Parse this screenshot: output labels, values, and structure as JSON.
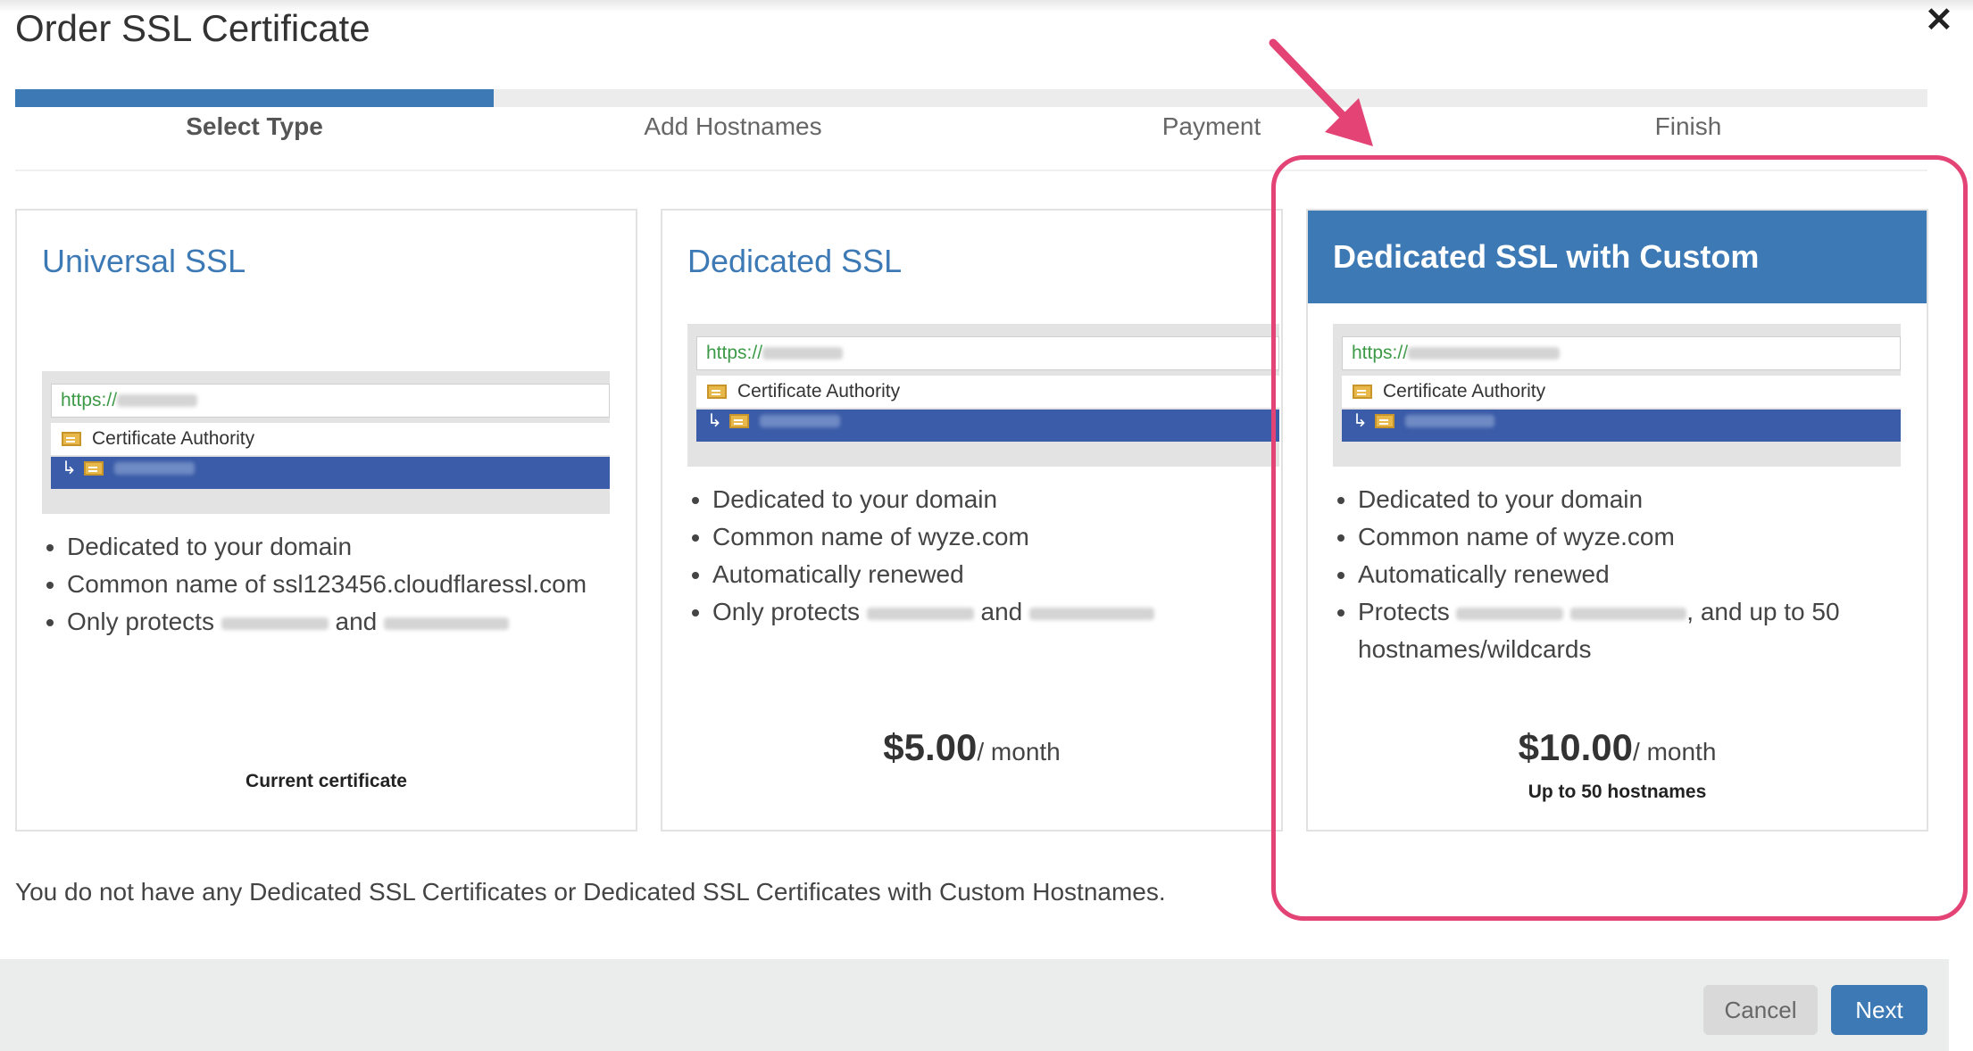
{
  "modal": {
    "title": "Order SSL Certificate"
  },
  "steps": [
    "Select Type",
    "Add Hostnames",
    "Payment",
    "Finish"
  ],
  "cards": [
    {
      "title": "Universal SSL",
      "cert": {
        "https": "https://",
        "ca": "Certificate Authority"
      },
      "features": [
        "Dedicated to your domain",
        "Common name of ssl123456.cloudflaressl.com",
        "Only protects",
        "and"
      ],
      "note": "Current certificate"
    },
    {
      "title": "Dedicated SSL",
      "cert": {
        "https": "https://",
        "ca": "Certificate Authority"
      },
      "features": [
        "Dedicated to your domain",
        "Common name of wyze.com",
        "Automatically renewed",
        "Only protects",
        "and"
      ],
      "price": {
        "amount": "$5.00",
        "per": "/ month"
      }
    },
    {
      "title": "Dedicated SSL with Custom Hostnames",
      "cert": {
        "https": "https://",
        "ca": "Certificate Authority"
      },
      "features": [
        "Dedicated to your domain",
        "Common name of wyze.com",
        "Automatically renewed",
        "Protects",
        ", and up to 50",
        "hostnames/wildcards"
      ],
      "price": {
        "amount": "$10.00",
        "per": "/ month"
      },
      "note": "Up to 50 hostnames"
    }
  ],
  "footer": {
    "message": "You do not have any Dedicated SSL Certificates or Dedicated SSL Certificates with Custom Hostnames.",
    "cancel": "Cancel",
    "next": "Next"
  },
  "colors": {
    "accent": "#3d7ab5",
    "highlight": "#e34375",
    "https_green": "#3c9a47",
    "selected_row": "#3b5ca8"
  }
}
